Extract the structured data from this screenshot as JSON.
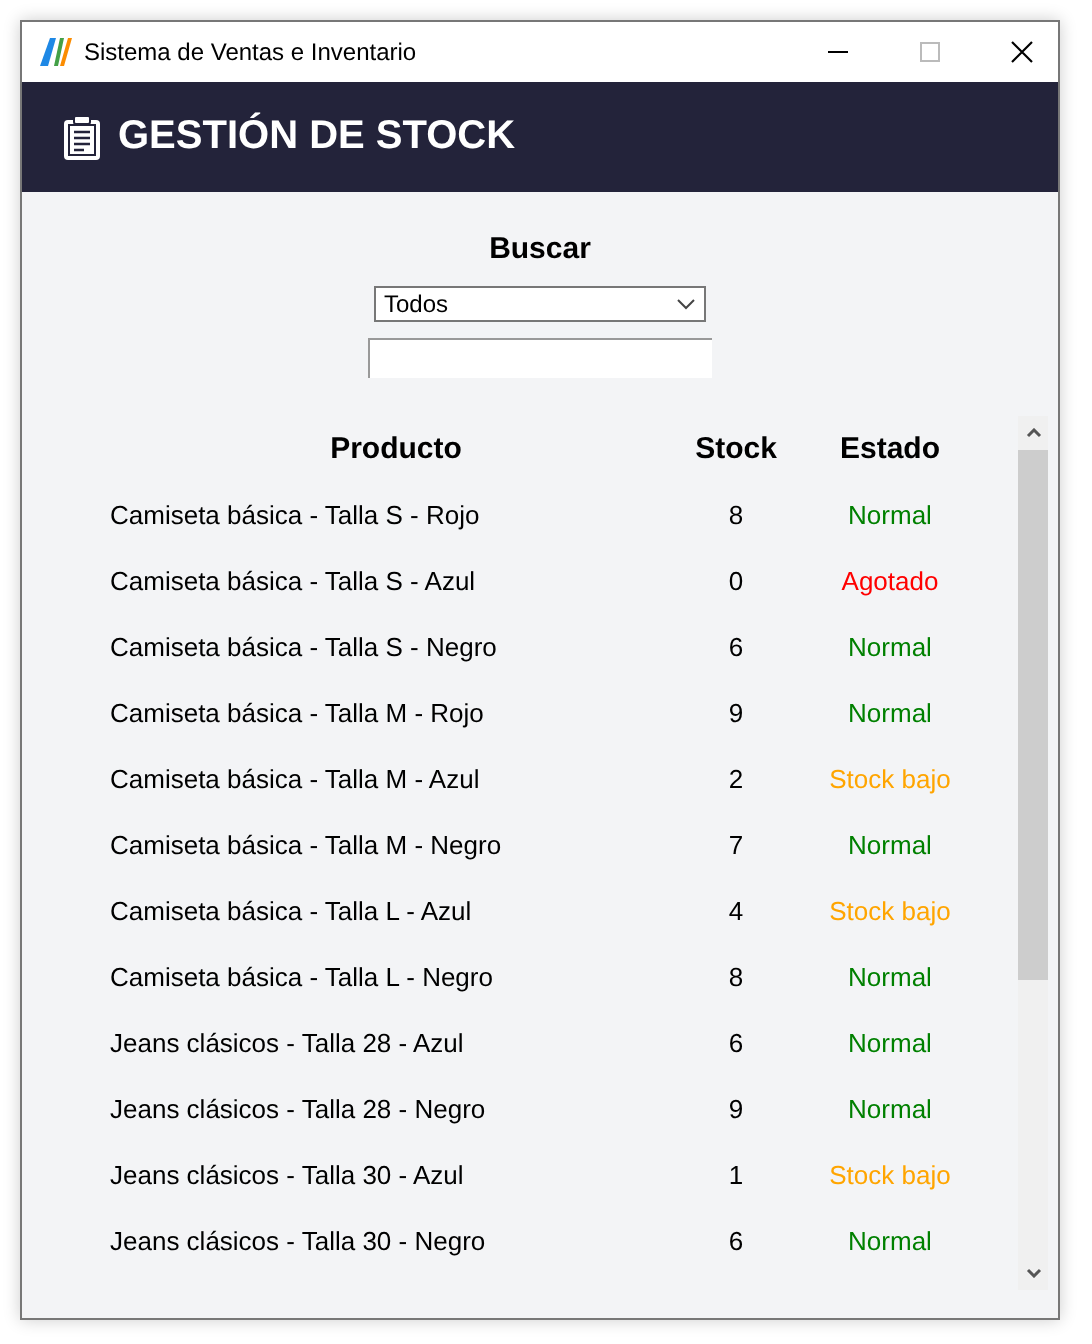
{
  "window": {
    "title": "Sistema de Ventas e Inventario"
  },
  "header": {
    "title": "GESTIÓN DE STOCK"
  },
  "search": {
    "label": "Buscar",
    "filter": "Todos"
  },
  "table": {
    "columns": [
      "Producto",
      "Stock",
      "Estado"
    ],
    "rows": [
      {
        "product": "Camiseta básica - Talla S - Rojo",
        "stock": "8",
        "status": "Normal",
        "kind": "normal"
      },
      {
        "product": "Camiseta básica - Talla S - Azul",
        "stock": "0",
        "status": "Agotado",
        "kind": "out"
      },
      {
        "product": "Camiseta básica - Talla S - Negro",
        "stock": "6",
        "status": "Normal",
        "kind": "normal"
      },
      {
        "product": "Camiseta básica - Talla M - Rojo",
        "stock": "9",
        "status": "Normal",
        "kind": "normal"
      },
      {
        "product": "Camiseta básica - Talla M - Azul",
        "stock": "2",
        "status": "Stock bajo",
        "kind": "low"
      },
      {
        "product": "Camiseta básica - Talla M - Negro",
        "stock": "7",
        "status": "Normal",
        "kind": "normal"
      },
      {
        "product": "Camiseta básica - Talla L - Azul",
        "stock": "4",
        "status": "Stock bajo",
        "kind": "low"
      },
      {
        "product": "Camiseta básica - Talla L - Negro",
        "stock": "8",
        "status": "Normal",
        "kind": "normal"
      },
      {
        "product": "Jeans clásicos - Talla 28 - Azul",
        "stock": "6",
        "status": "Normal",
        "kind": "normal"
      },
      {
        "product": "Jeans clásicos - Talla 28 - Negro",
        "stock": "9",
        "status": "Normal",
        "kind": "normal"
      },
      {
        "product": "Jeans clásicos - Talla 30 - Azul",
        "stock": "1",
        "status": "Stock bajo",
        "kind": "low"
      },
      {
        "product": "Jeans clásicos - Talla 30 - Negro",
        "stock": "6",
        "status": "Normal",
        "kind": "normal"
      }
    ]
  }
}
